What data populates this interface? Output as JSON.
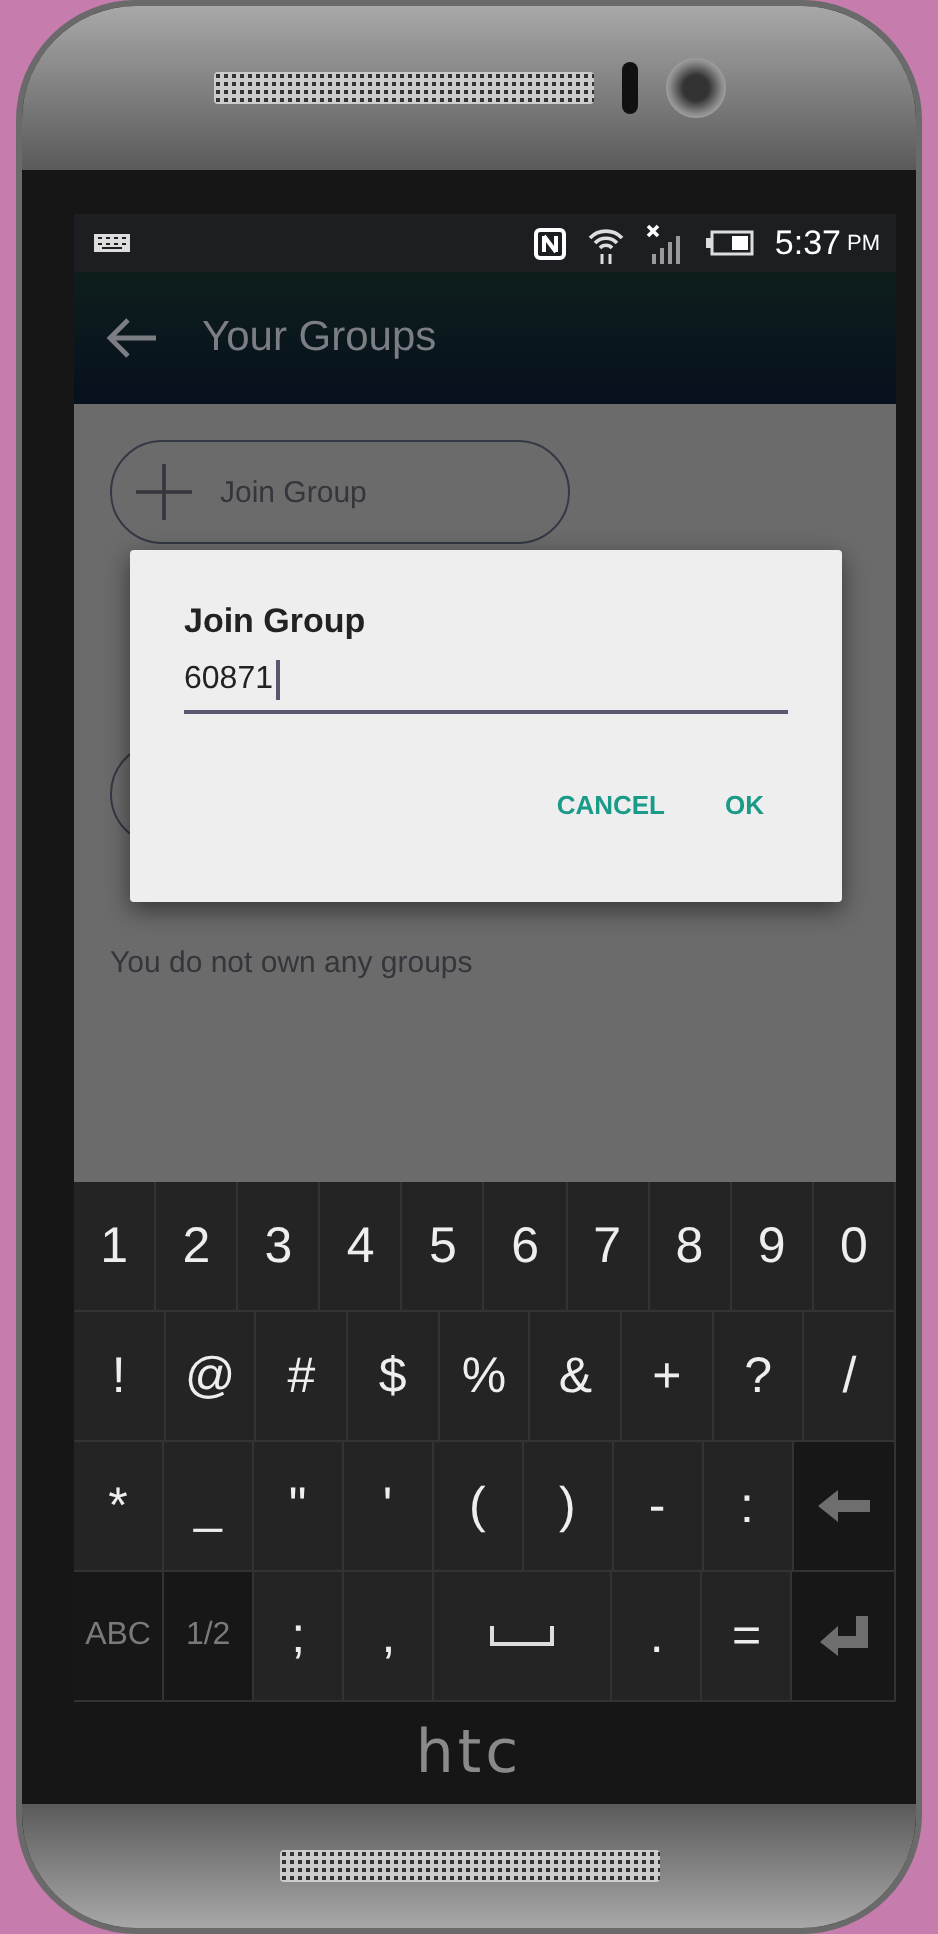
{
  "status_bar": {
    "time": "5:37",
    "period": "PM"
  },
  "app_bar": {
    "title": "Your Groups"
  },
  "buttons": [
    {
      "kind": "labeled",
      "label": "Join Group"
    },
    {
      "kind": "covered"
    }
  ],
  "empty_message": "You do not own any groups",
  "dialog": {
    "title": "Join Group",
    "value": "60871",
    "actions": [
      "CANCEL",
      "OK"
    ]
  },
  "keyboard": {
    "rows": [
      {
        "keys": [
          {
            "kind": "char",
            "label": "1"
          },
          {
            "kind": "char",
            "label": "2"
          },
          {
            "kind": "char",
            "label": "3"
          },
          {
            "kind": "char",
            "label": "4"
          },
          {
            "kind": "char",
            "label": "5"
          },
          {
            "kind": "char",
            "label": "6"
          },
          {
            "kind": "char",
            "label": "7"
          },
          {
            "kind": "char",
            "label": "8"
          },
          {
            "kind": "char",
            "label": "9"
          },
          {
            "kind": "char",
            "label": "0"
          }
        ]
      },
      {
        "keys": [
          {
            "kind": "char",
            "label": "!"
          },
          {
            "kind": "char",
            "label": "@"
          },
          {
            "kind": "char",
            "label": "#"
          },
          {
            "kind": "char",
            "label": "$"
          },
          {
            "kind": "char",
            "label": "%"
          },
          {
            "kind": "char",
            "label": "&"
          },
          {
            "kind": "char",
            "label": "+"
          },
          {
            "kind": "char",
            "label": "?"
          },
          {
            "kind": "char",
            "label": "/"
          }
        ]
      },
      {
        "keys": [
          {
            "kind": "char",
            "label": "*"
          },
          {
            "kind": "char",
            "label": "_"
          },
          {
            "kind": "char",
            "label": "\""
          },
          {
            "kind": "char",
            "label": "'"
          },
          {
            "kind": "char",
            "label": "("
          },
          {
            "kind": "char",
            "label": ")"
          },
          {
            "kind": "char",
            "label": "-"
          },
          {
            "kind": "char",
            "label": ":"
          },
          {
            "kind": "backspace"
          }
        ]
      },
      {
        "keys": [
          {
            "kind": "mode",
            "label": "ABC"
          },
          {
            "kind": "mode",
            "label": "1/2"
          },
          {
            "kind": "char",
            "label": ";"
          },
          {
            "kind": "char",
            "label": ","
          },
          {
            "kind": "space"
          },
          {
            "kind": "char",
            "label": "."
          },
          {
            "kind": "char",
            "label": "="
          },
          {
            "kind": "enter"
          }
        ]
      }
    ]
  },
  "brand": "htc"
}
